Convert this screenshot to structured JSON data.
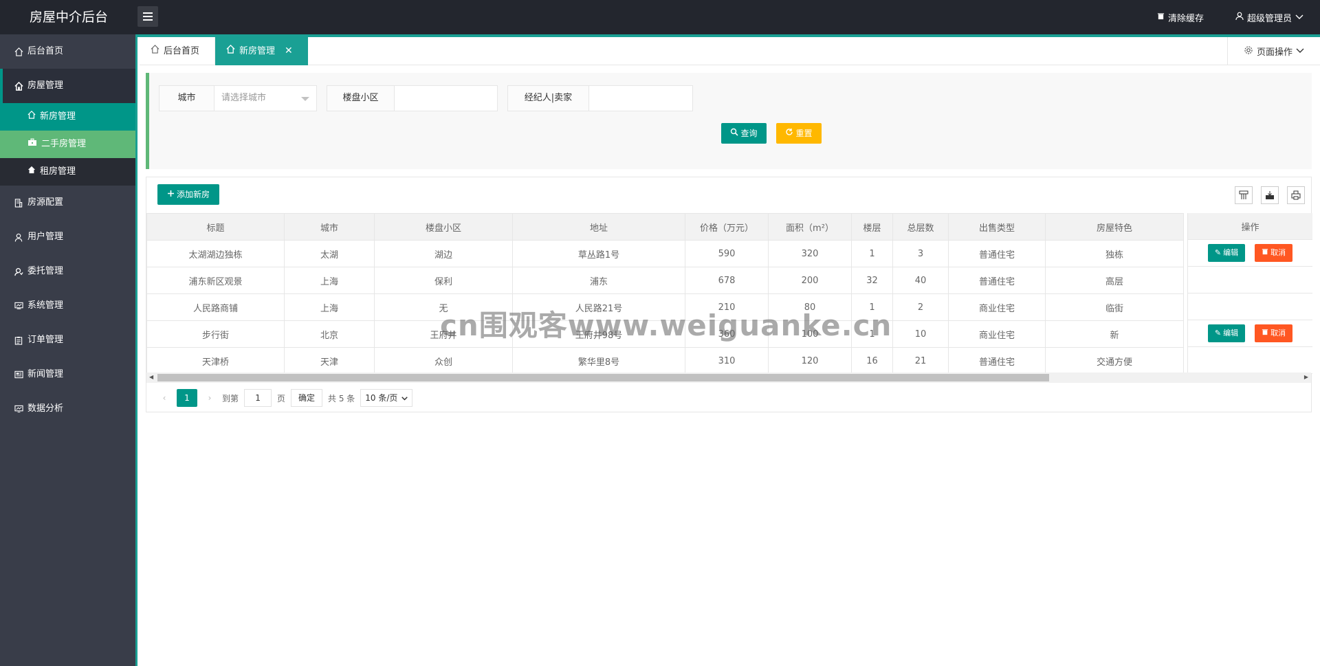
{
  "app": {
    "title": "房屋中介后台"
  },
  "header": {
    "clear_cache": "清除缓存",
    "admin": "超级管理员"
  },
  "sidebar": {
    "items": [
      {
        "label": "后台首页",
        "icon": "home-icon"
      },
      {
        "label": "房屋管理",
        "icon": "house-icon"
      },
      {
        "label": "房源配置",
        "icon": "building-icon"
      },
      {
        "label": "用户管理",
        "icon": "user-icon"
      },
      {
        "label": "委托管理",
        "icon": "handshake-icon"
      },
      {
        "label": "系统管理",
        "icon": "monitor-icon"
      },
      {
        "label": "订单管理",
        "icon": "clipboard-icon"
      },
      {
        "label": "新闻管理",
        "icon": "news-icon"
      },
      {
        "label": "数据分析",
        "icon": "chart-icon"
      }
    ],
    "sub_items": [
      {
        "label": "新房管理"
      },
      {
        "label": "二手房管理"
      },
      {
        "label": "租房管理"
      }
    ]
  },
  "tabs": {
    "home": "后台首页",
    "active": "新房管理",
    "page_ops": "页面操作"
  },
  "search": {
    "city_label": "城市",
    "city_placeholder": "请选择城市",
    "community_label": "楼盘小区",
    "agent_label": "经纪人|卖家",
    "query_btn": "查询",
    "reset_btn": "重置"
  },
  "toolbar": {
    "add_btn": "添加新房"
  },
  "table": {
    "headers": [
      "标题",
      "城市",
      "楼盘小区",
      "地址",
      "价格（万元）",
      "面积（m²）",
      "楼层",
      "总层数",
      "出售类型",
      "房屋特色"
    ],
    "ops_header": "操作",
    "edit_label": "编辑",
    "cancel_label": "取消",
    "rows": [
      [
        "太湖湖边独栋",
        "太湖",
        "湖边",
        "草丛路1号",
        "590",
        "320",
        "1",
        "3",
        "普通住宅",
        "独栋"
      ],
      [
        "浦东新区观景",
        "上海",
        "保利",
        "浦东",
        "678",
        "200",
        "32",
        "40",
        "普通住宅",
        "高层"
      ],
      [
        "人民路商铺",
        "上海",
        "无",
        "人民路21号",
        "210",
        "80",
        "1",
        "2",
        "商业住宅",
        "临街"
      ],
      [
        "步行街",
        "北京",
        "王府井",
        "王府井98号",
        "360",
        "100",
        "1",
        "10",
        "商业住宅",
        "新"
      ],
      [
        "天津桥",
        "天津",
        "众创",
        "繁华里8号",
        "310",
        "120",
        "16",
        "21",
        "普通住宅",
        "交通方便"
      ]
    ]
  },
  "pager": {
    "current": "1",
    "goto_label": "到第",
    "goto_value": "1",
    "page_label": "页",
    "ok": "确定",
    "total": "共 5 条",
    "per_page": "10 条/页"
  },
  "watermark": "cn围观客www.weiguanke.cn",
  "colors": {
    "primary": "#009688",
    "accent": "#1aa094",
    "hover": "#5fb878",
    "warn": "#ffb800",
    "danger": "#ff5722",
    "dark": "#23262e",
    "sidebar": "#393d49"
  }
}
